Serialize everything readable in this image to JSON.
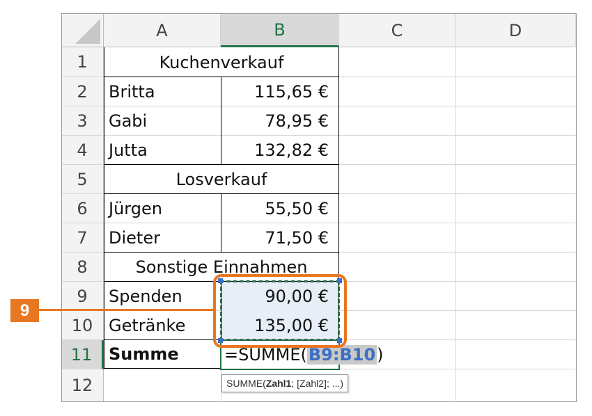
{
  "columns": [
    "A",
    "B",
    "C",
    "D"
  ],
  "rows": [
    "1",
    "2",
    "3",
    "4",
    "5",
    "6",
    "7",
    "8",
    "9",
    "10",
    "11",
    "12"
  ],
  "cells": {
    "r1": "Kuchenverkauf",
    "r2": {
      "name": "Britta",
      "value": "115,65 €"
    },
    "r3": {
      "name": "Gabi",
      "value": "78,95 €"
    },
    "r4": {
      "name": "Jutta",
      "value": "132,82 €"
    },
    "r5": "Losverkauf",
    "r6": {
      "name": "Jürgen",
      "value": "55,50 €"
    },
    "r7": {
      "name": "Dieter",
      "value": "71,50 €"
    },
    "r8": "Sonstige Einnahmen",
    "r9": {
      "name": "Spenden",
      "value": "90,00 €"
    },
    "r10": {
      "name": "Getränke",
      "value": "135,00 €"
    },
    "r11": {
      "name": "Summe",
      "formula_prefix": "=SUMME(",
      "formula_ref": "B9:B10",
      "formula_suffix": ")"
    }
  },
  "tooltip": {
    "fn": "SUMME(",
    "arg1": "Zahl1",
    "rest": "; [Zahl2]; ...)"
  },
  "callout": "9",
  "colors": {
    "accent": "#217346",
    "callout": "#e87722",
    "ref_blue": "#3d6fc4",
    "range_fill": "#e8eef8"
  }
}
